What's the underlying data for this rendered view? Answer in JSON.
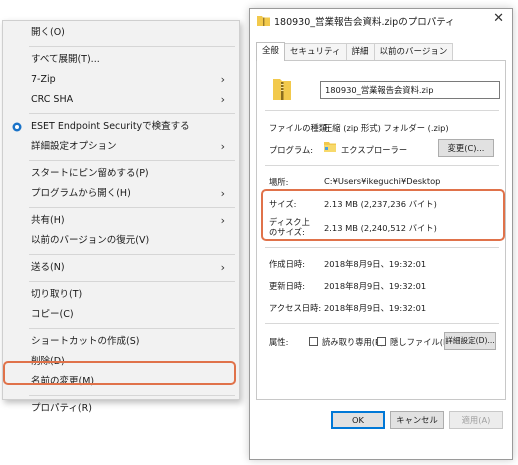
{
  "context_menu": {
    "items": [
      {
        "label": "開く(O)"
      },
      {
        "label": "すべて展開(T)..."
      },
      {
        "label": "7-Zip",
        "submenu": true
      },
      {
        "label": "CRC SHA",
        "submenu": true
      },
      {
        "label": "ESET Endpoint Securityで検査する",
        "icon": "eset-icon"
      },
      {
        "label": "詳細設定オプション",
        "submenu": true
      },
      {
        "label": "スタートにピン留めする(P)"
      },
      {
        "label": "プログラムから開く(H)",
        "submenu": true
      },
      {
        "label": "共有(H)",
        "submenu": true
      },
      {
        "label": "以前のバージョンの復元(V)"
      },
      {
        "label": "送る(N)",
        "submenu": true
      },
      {
        "label": "切り取り(T)"
      },
      {
        "label": "コピー(C)"
      },
      {
        "label": "ショートカットの作成(S)"
      },
      {
        "label": "削除(D)"
      },
      {
        "label": "名前の変更(M)"
      },
      {
        "label": "プロパティ(R)"
      }
    ],
    "arrow_glyph": "›",
    "highlight_color": "#e0724a"
  },
  "dialog": {
    "title": "180930_営業報告会資料.zipのプロパティ",
    "close_glyph": "✕",
    "tabs": [
      "全般",
      "セキュリティ",
      "詳細",
      "以前のバージョン"
    ],
    "active_tab": "全般",
    "file_name": "180930_営業報告会資料.zip",
    "type_label": "ファイルの種類:",
    "type_value": "圧縮 (zip 形式) フォルダー (.zip)",
    "program_label": "プログラム:",
    "program_value": "エクスプローラー",
    "change_button": "変更(C)...",
    "location_label": "場所:",
    "location_value": "C:¥Users¥ikeguchi¥Desktop",
    "size_label": "サイズ:",
    "size_value": "2.13 MB (2,237,236 バイト)",
    "disk_size_label_1": "ディスク上",
    "disk_size_label_2": "のサイズ:",
    "disk_size_value": "2.13 MB (2,240,512 バイト)",
    "created_label": "作成日時:",
    "created_value": "2018年8月9日、19:32:01",
    "modified_label": "更新日時:",
    "modified_value": "2018年8月9日、19:32:01",
    "accessed_label": "アクセス日時:",
    "accessed_value": "2018年8月9日、19:32:01",
    "attributes_label": "属性:",
    "readonly_label": "読み取り専用(R)",
    "hidden_label": "隠しファイル(H)",
    "advanced_button": "詳細設定(D)...",
    "ok_button": "OK",
    "cancel_button": "キャンセル",
    "apply_button": "適用(A)"
  }
}
